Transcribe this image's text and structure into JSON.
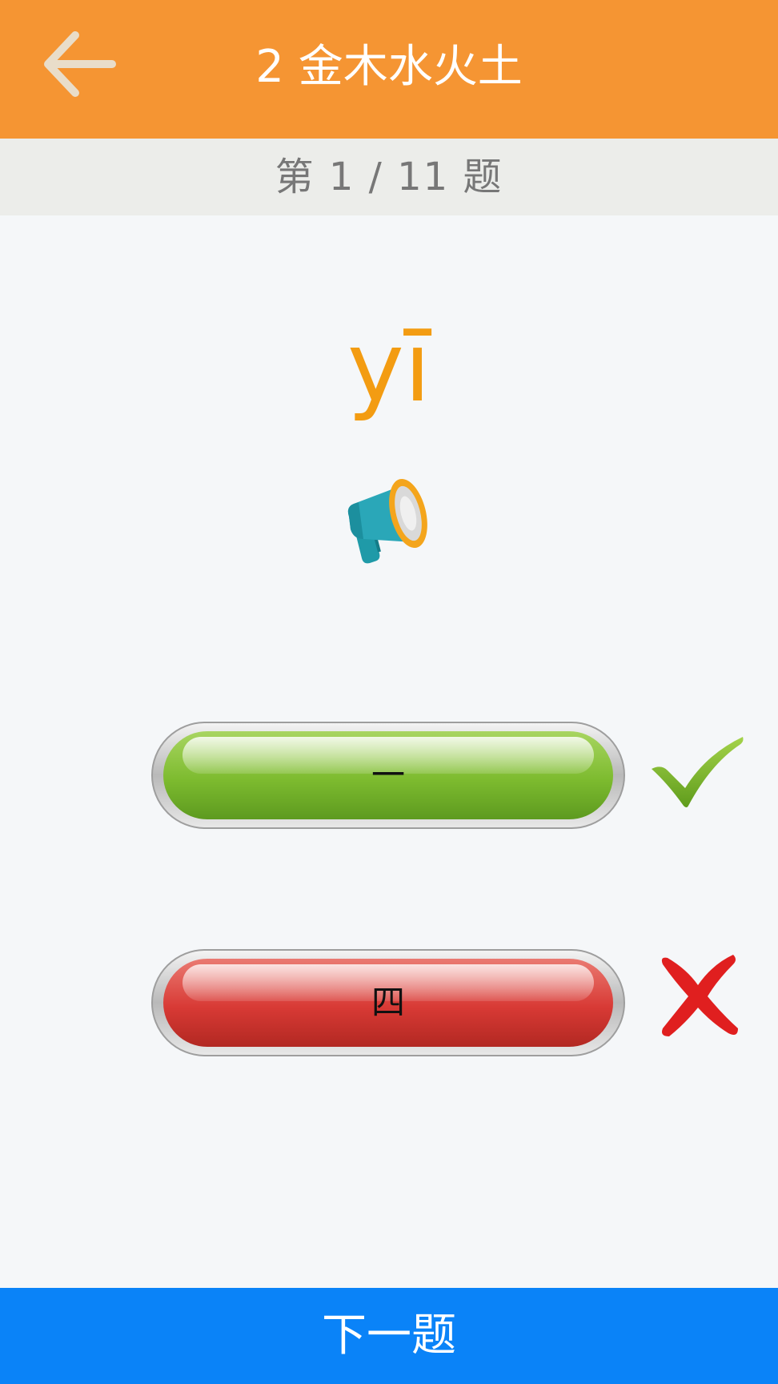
{
  "header": {
    "title": "2 金木水火土",
    "back_icon": "arrow-left-icon"
  },
  "progress": {
    "text": "第 1 / 11 题",
    "current": 1,
    "total": 11
  },
  "question": {
    "pinyin": "yī",
    "audio_icon": "megaphone-icon"
  },
  "options": [
    {
      "label": "一",
      "state": "correct",
      "marker_icon": "check-mark-icon"
    },
    {
      "label": "四",
      "state": "wrong",
      "marker_icon": "cross-mark-icon"
    }
  ],
  "footer": {
    "next_label": "下一题"
  },
  "colors": {
    "header": "#f59533",
    "progress_bg": "#ecedea",
    "pinyin": "#f39c12",
    "correct": "#7dbb2f",
    "wrong": "#d83a35",
    "footer": "#0a83f8"
  }
}
